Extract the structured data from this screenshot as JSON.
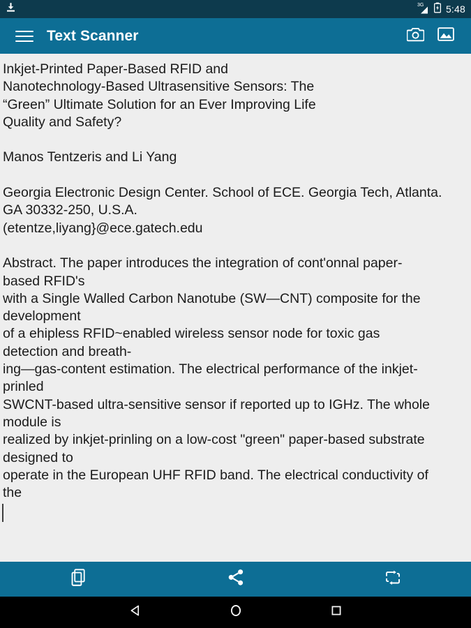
{
  "status_bar": {
    "download_icon": "download-icon",
    "network_label": "3G",
    "signal_icon": "signal-3g-icon",
    "battery_icon": "battery-icon",
    "clock": "5:48",
    "background_color": "#0d3a4d"
  },
  "app_bar": {
    "menu_icon": "hamburger-menu-icon",
    "title": "Text Scanner",
    "camera_icon": "camera-icon",
    "gallery_icon": "gallery-image-icon",
    "background_color": "#0d6e95"
  },
  "content": {
    "ocr_text": "Inkjet-Printed Paper-Based RFID and\nNanotechnology-Based Ultrasensitive Sensors: The\n“Green” Ultimate Solution for an Ever Improving Life\nQuality and Safety?\n\nManos Tentzeris and Li Yang\n\nGeorgia Electronic Design Center. School of ECE. Georgia Tech, Atlanta.\nGA 30332-250, U.S.A.\n(etentze,liyang}@ece.gatech.edu\n\nAbstract. The paper introduces the integration of cont'onnal paper-\nbased RFID's\nwith a Single Walled Carbon Nanotube (SW—CNT) composite for the\ndevelopment\nof a ehipless RFID~enabled wireless sensor node for toxic gas\ndetection and breath-\ning—gas-content estimation. The electrical performance of the inkjet-\nprinled\nSWCNT-based ultra-sensitive sensor if reported up to IGHz. The whole\nmodule is\nrealized by inkjet-prinling on a low-cost \"green\" paper-based substrate\ndesigned to\noperate in the European UHF RFID band. The electrical conductivity of\nthe",
    "text_color": "#1b1b1b",
    "background_color": "#eeeeee"
  },
  "bottom_toolbar": {
    "items": [
      {
        "icon": "copy-icon",
        "label": "Copy"
      },
      {
        "icon": "share-icon",
        "label": "Share"
      },
      {
        "icon": "translate-swap-icon",
        "label": "Translate"
      }
    ],
    "background_color": "#0d6e95"
  },
  "nav_bar": {
    "back_icon": "back-triangle-icon",
    "home_icon": "home-circle-icon",
    "recents_icon": "recents-square-icon",
    "background_color": "#000000"
  }
}
